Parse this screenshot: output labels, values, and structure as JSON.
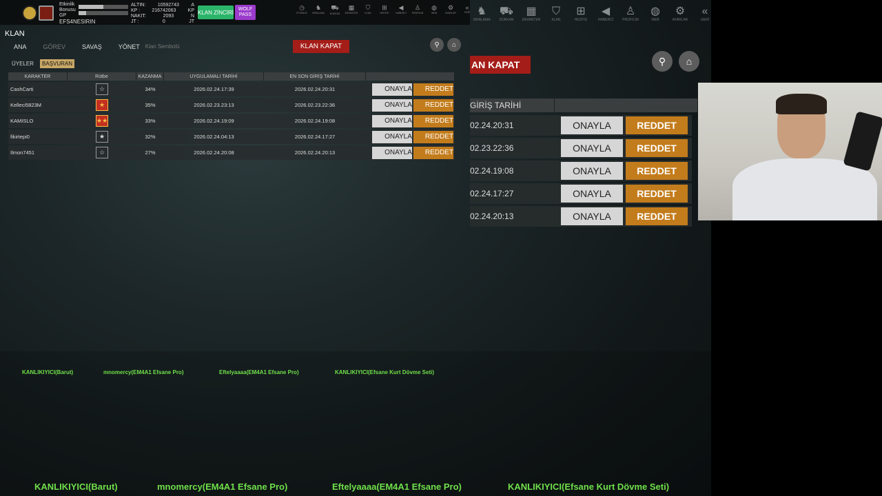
{
  "topbar": {
    "player_name": "EFS4NESIRIN",
    "bar_labels": [
      "Etkinlik",
      "Bonusu",
      "GP"
    ],
    "bar_fill": [
      0.5,
      0.15
    ],
    "stats": [
      {
        "label": "ALTIN:",
        "value": "10592743",
        "unit": "A"
      },
      {
        "label": "KP :",
        "value": "216742063",
        "unit": "KP"
      },
      {
        "label": "NAKIT:",
        "value": "2093",
        "unit": "N"
      },
      {
        "label": "JT :",
        "value": "0",
        "unit": "JT"
      }
    ],
    "klan_zinciri": "KLAN ZİNCİRİ",
    "wolf_pass": [
      "WOLF",
      "PASS"
    ]
  },
  "mini_nav": [
    {
      "icon": "clock-icon",
      "glyph": "◷",
      "label": "ETKİNLİK"
    },
    {
      "icon": "wolf-icon",
      "glyph": "♞",
      "label": "SIRALAMA"
    },
    {
      "icon": "cart-icon",
      "glyph": "⛟",
      "label": "DÜKKAN"
    },
    {
      "icon": "inventory-icon",
      "glyph": "▦",
      "label": "ENVANTER"
    },
    {
      "icon": "shield-icon",
      "glyph": "⛉",
      "label": "KLAN"
    },
    {
      "icon": "gift-icon",
      "glyph": "⊞",
      "label": "HEDİYE"
    },
    {
      "icon": "megaphone-icon",
      "glyph": "◀",
      "label": "HABERCİ"
    },
    {
      "icon": "profile-icon",
      "glyph": "♙",
      "label": "PROFİLİM"
    },
    {
      "icon": "web-icon",
      "glyph": "◍",
      "label": "WEB"
    },
    {
      "icon": "settings-icon",
      "glyph": "⚙",
      "label": "AYARLAR"
    },
    {
      "icon": "back-icon",
      "glyph": "«",
      "label": "GERİ"
    }
  ],
  "big_nav": [
    {
      "icon": "wolf-icon",
      "glyph": "♞",
      "label": "SIRALAMA"
    },
    {
      "icon": "cart-icon",
      "glyph": "⛟",
      "label": "DÜKKAN"
    },
    {
      "icon": "inventory-icon",
      "glyph": "▦",
      "label": "ENVANTER"
    },
    {
      "icon": "shield-icon",
      "glyph": "⛉",
      "label": "KLAN"
    },
    {
      "icon": "gift-icon",
      "glyph": "⊞",
      "label": "HEDİYE"
    },
    {
      "icon": "megaphone-icon",
      "glyph": "◀",
      "label": "HABERCİ"
    },
    {
      "icon": "profile-icon",
      "glyph": "♙",
      "label": "PROFİLİM"
    },
    {
      "icon": "web-icon",
      "glyph": "◍",
      "label": "WEB"
    },
    {
      "icon": "settings-icon",
      "glyph": "⚙",
      "label": "AYARLAR"
    },
    {
      "icon": "back-icon",
      "glyph": "«",
      "label": "GERİ"
    }
  ],
  "panel": {
    "title": "KLAN",
    "tabs": [
      "ANA",
      "GÖREV",
      "SAVAŞ",
      "YÖNET"
    ],
    "klan_sembolu": "Klan Sembolü",
    "klan_kapat": "KLAN KAPAT",
    "subtabs": [
      "ÜYELER",
      "BAŞVURAN"
    ],
    "columns": [
      "KARAKTER",
      "Rütbe",
      "KAZANMA",
      "UYGULAMALI TARİHİ",
      "EN SON GİRİŞ TARİHİ"
    ],
    "approve_label": "ONAYLA",
    "reject_label": "REDDET"
  },
  "applicants": [
    {
      "name": "CashCarti",
      "rank": "☆",
      "rank_red": false,
      "win": "34%",
      "applied": "2026.02.24.17:39",
      "last_login": "2026.02.24.20:31"
    },
    {
      "name": "Kelleci5823M",
      "rank": "★",
      "rank_red": true,
      "win": "35%",
      "applied": "2026.02.23.23:13",
      "last_login": "2026.02.23.22:36"
    },
    {
      "name": "KAMISLO",
      "rank": "★★",
      "rank_red": true,
      "win": "33%",
      "applied": "2026.02.24.19:09",
      "last_login": "2026.02.24.19:08"
    },
    {
      "name": "fikirtepi0",
      "rank": "★",
      "rank_red": false,
      "win": "32%",
      "applied": "2026.02.24.04:13",
      "last_login": "2026.02.24.17:27"
    },
    {
      "name": "Ilmon7451",
      "rank": "☆",
      "rank_red": false,
      "win": "27%",
      "applied": "2026.02.24.20:08",
      "last_login": "2026.02.24.20:13"
    }
  ],
  "zoom": {
    "kapat": "AN KAPAT",
    "header": "GİRİŞ TARİHİ",
    "dates": [
      "02.24.20:31",
      "02.23.22:36",
      "02.24.19:08",
      "02.24.17:27",
      "02.24.20:13"
    ]
  },
  "ticker": [
    "KANLIKIYICI(Barut)",
    "mnomercy(EM4A1 Efsane Pro)",
    "Eftelyaaaa(EM4A1 Efsane Pro)",
    "KANLIKIYICI(Efsane Kurt Dövme Seti)"
  ]
}
